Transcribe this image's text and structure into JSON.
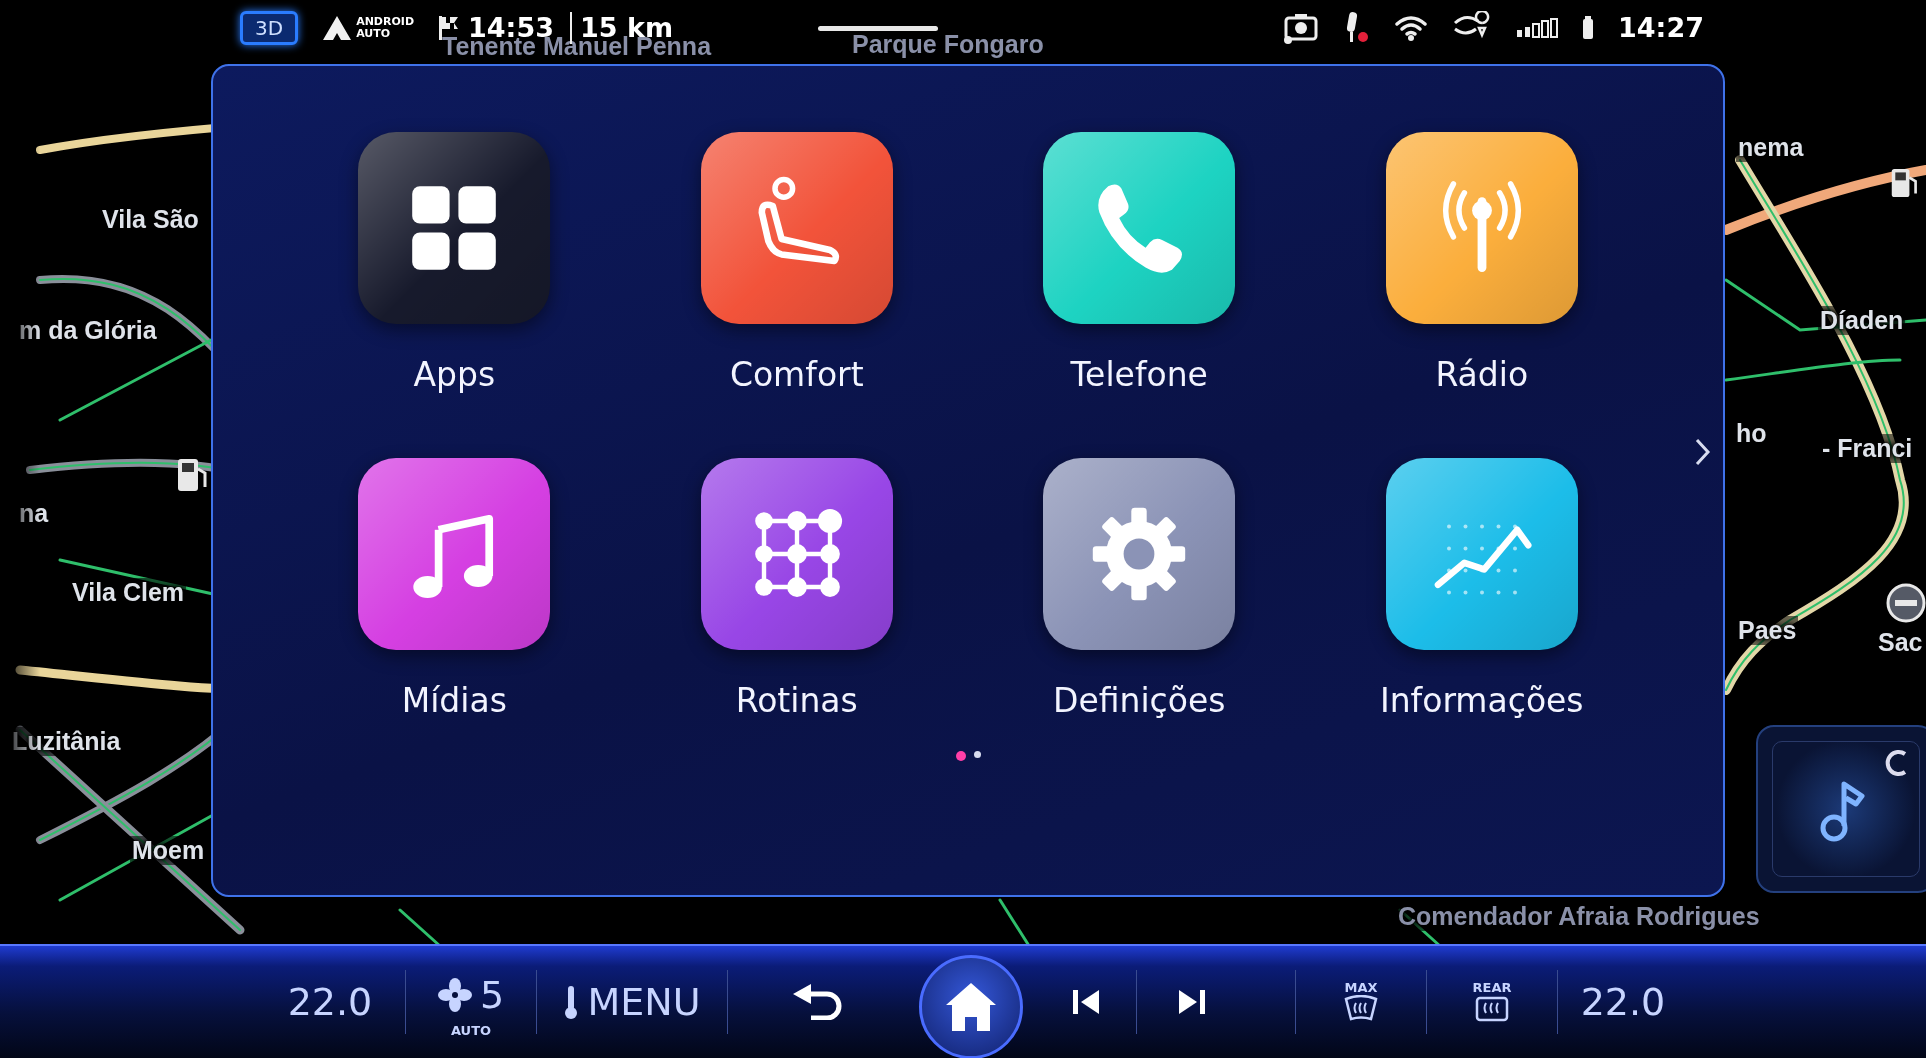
{
  "status_bar": {
    "view_button": "3D",
    "android_auto": [
      "ANDROID",
      "AUTO"
    ],
    "arrival_time": "14:53",
    "distance": "15 km",
    "clock": "14:27"
  },
  "map": {
    "labels": [
      {
        "text": "Tenente Manuel Penna"
      },
      {
        "text": "Parque Fongaro"
      },
      {
        "text": "Vila São"
      },
      {
        "text": "m da Glória"
      },
      {
        "text": "na"
      },
      {
        "text": "Vila Clem"
      },
      {
        "text": "Luzitânia"
      },
      {
        "text": "Moem"
      },
      {
        "text": "nema"
      },
      {
        "text": "Díaden"
      },
      {
        "text": "ho"
      },
      {
        "text": "- Franci"
      },
      {
        "text": "Paes"
      },
      {
        "text": "Sac"
      },
      {
        "text": "Comendador Afraia Rodrigues"
      }
    ]
  },
  "launcher": {
    "apps": [
      {
        "label": "Apps",
        "kind": "grid",
        "color": "#171a2c"
      },
      {
        "label": "Comfort",
        "kind": "seat",
        "color": "#f2533a"
      },
      {
        "label": "Telefone",
        "kind": "phone",
        "color": "#1dd3c2"
      },
      {
        "label": "Rádio",
        "kind": "radio",
        "color": "#fbae3c"
      },
      {
        "label": "Mídias",
        "kind": "music",
        "color": "#d53fe2"
      },
      {
        "label": "Rotinas",
        "kind": "routines",
        "color": "#9846e6"
      },
      {
        "label": "Definições",
        "kind": "gear",
        "color": "#8b93b6"
      },
      {
        "label": "Informações",
        "kind": "chart",
        "color": "#1cbde9"
      }
    ],
    "pages": [
      {
        "selected": true
      },
      {
        "selected": false
      }
    ]
  },
  "climate_bar": {
    "left_temp": "22.0",
    "fan_speed": "5",
    "fan_mode": "AUTO",
    "menu": "MENU",
    "max_label": "MAX",
    "rear_label": "REAR",
    "right_temp": "22.0"
  }
}
